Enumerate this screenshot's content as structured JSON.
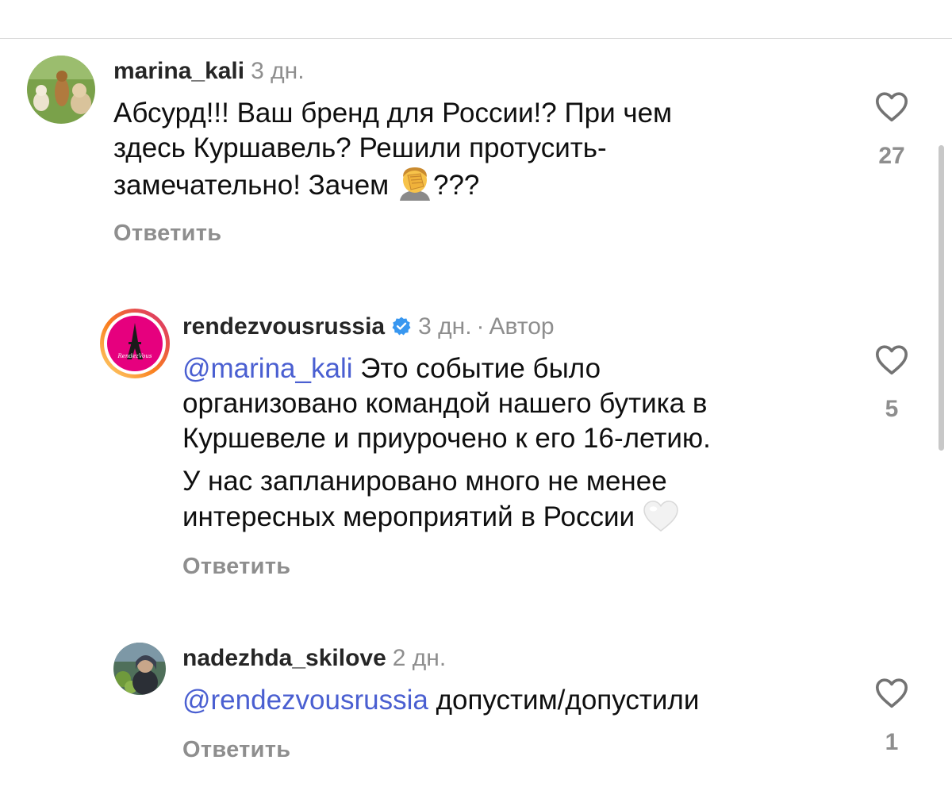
{
  "comments": [
    {
      "username": "marina_kali",
      "time": "3 дн.",
      "text_line1": "Абсурд!!! Ваш бренд для России!? При чем",
      "text_line2": "здесь Куршавель? Решили протусить-",
      "text_line3": "замечательно! Зачем",
      "text_line3_tail": "???",
      "reply_label": "Ответить",
      "likes": "27",
      "avatar_icon": "dogs-photo-avatar",
      "emoji_icon": "face-palm-emoji"
    },
    {
      "username": "rendezvousrussia",
      "time": "3 дн.",
      "separator": "·",
      "author_label": "Автор",
      "mention": "@marina_kali",
      "para1_line1": "Это событие было",
      "para1_line2": "организовано командой нашего бутика в",
      "para1_line3": "Куршевеле и приурочено к его 16-летию.",
      "para2_line1": "У нас запланировано много не менее",
      "para2_line2": "интересных мероприятий в России",
      "reply_label": "Ответить",
      "likes": "5",
      "avatar_icon": "rendezvous-logo-avatar",
      "avatar_logo_text": "RendezVous",
      "verified_icon": "verified-badge-icon",
      "emoji_icon": "white-heart-emoji"
    },
    {
      "username": "nadezhda_skilove",
      "time": "2 дн.",
      "mention": "@rendezvousrussia",
      "text": "допустим/допустили",
      "reply_label": "Ответить",
      "likes": "1",
      "avatar_icon": "user-photo-avatar"
    }
  ],
  "colors": {
    "mention": "#4a5fd1",
    "secondary_text": "#8e8e8e",
    "verified": "#3897f0",
    "story_ring_start": "#feda75",
    "story_ring_end": "#d62976",
    "logo_bg": "#e6007e"
  }
}
